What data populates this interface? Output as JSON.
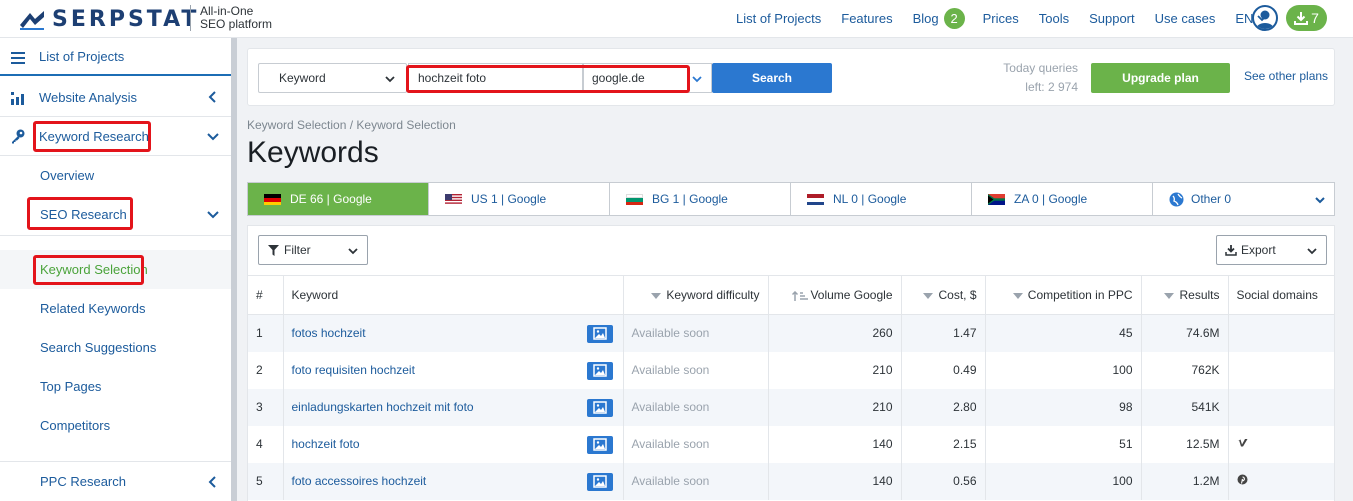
{
  "header": {
    "logo_text": "SERPSTAT",
    "tagline_line1": "All-in-One",
    "tagline_line2": "SEO platform",
    "nav": [
      "List of Projects",
      "Features",
      "Blog",
      "Prices",
      "Tools",
      "Support",
      "Use cases"
    ],
    "blog_badge": "2",
    "language": "EN",
    "downloads_count": "7"
  },
  "sidebar": {
    "list_of_projects": "List of Projects",
    "website_analysis": "Website Analysis",
    "keyword_research": "Keyword Research",
    "overview": "Overview",
    "seo_research": "SEO Research",
    "keyword_selection": "Keyword Selection",
    "related_keywords": "Related Keywords",
    "search_suggestions": "Search Suggestions",
    "top_pages": "Top Pages",
    "competitors": "Competitors",
    "ppc_research": "PPC Research"
  },
  "search": {
    "type_select": "Keyword",
    "query": "hochzeit foto",
    "database": "google.de",
    "button": "Search",
    "queries_label": "Today queries",
    "queries_left": "left: 2 974",
    "upgrade": "Upgrade plan",
    "see_plans": "See other plans"
  },
  "breadcrumb": "Keyword Selection / Keyword Selection",
  "page_title": "Keywords",
  "db_tabs": [
    {
      "label": "DE 66 | Google",
      "flag": "de"
    },
    {
      "label": "US 1 | Google",
      "flag": "us"
    },
    {
      "label": "BG 1 | Google",
      "flag": "bg"
    },
    {
      "label": "NL 0 | Google",
      "flag": "nl"
    },
    {
      "label": "ZA 0 | Google",
      "flag": "za"
    },
    {
      "label": "Other 0",
      "flag": "globe"
    }
  ],
  "toolbar": {
    "filter": "Filter",
    "export": "Export"
  },
  "table": {
    "columns": [
      "#",
      "Keyword",
      "Keyword difficulty",
      "Volume Google",
      "Cost, $",
      "Competition in PPC",
      "Results",
      "Social domains"
    ],
    "rows": [
      {
        "n": "1",
        "keyword": "fotos hochzeit",
        "difficulty": "Available soon",
        "volume": "260",
        "cost": "1.47",
        "competition": "45",
        "results": "74.6M",
        "social": ""
      },
      {
        "n": "2",
        "keyword": "foto requisiten hochzeit",
        "difficulty": "Available soon",
        "volume": "210",
        "cost": "0.49",
        "competition": "100",
        "results": "762K",
        "social": ""
      },
      {
        "n": "3",
        "keyword": "einladungskarten hochzeit mit foto",
        "difficulty": "Available soon",
        "volume": "210",
        "cost": "2.80",
        "competition": "98",
        "results": "541K",
        "social": ""
      },
      {
        "n": "4",
        "keyword": "hochzeit foto",
        "difficulty": "Available soon",
        "volume": "140",
        "cost": "2.15",
        "competition": "51",
        "results": "12.5M",
        "social": "vimeo-icon"
      },
      {
        "n": "5",
        "keyword": "foto accessoires hochzeit",
        "difficulty": "Available soon",
        "volume": "140",
        "cost": "0.56",
        "competition": "100",
        "results": "1.2M",
        "social": "pinterest-icon"
      }
    ]
  },
  "colors": {
    "brand_blue": "#1c5b9c",
    "accent_green": "#6bb34a",
    "search_blue": "#2b78d0",
    "highlight_red": "#e3141b"
  }
}
